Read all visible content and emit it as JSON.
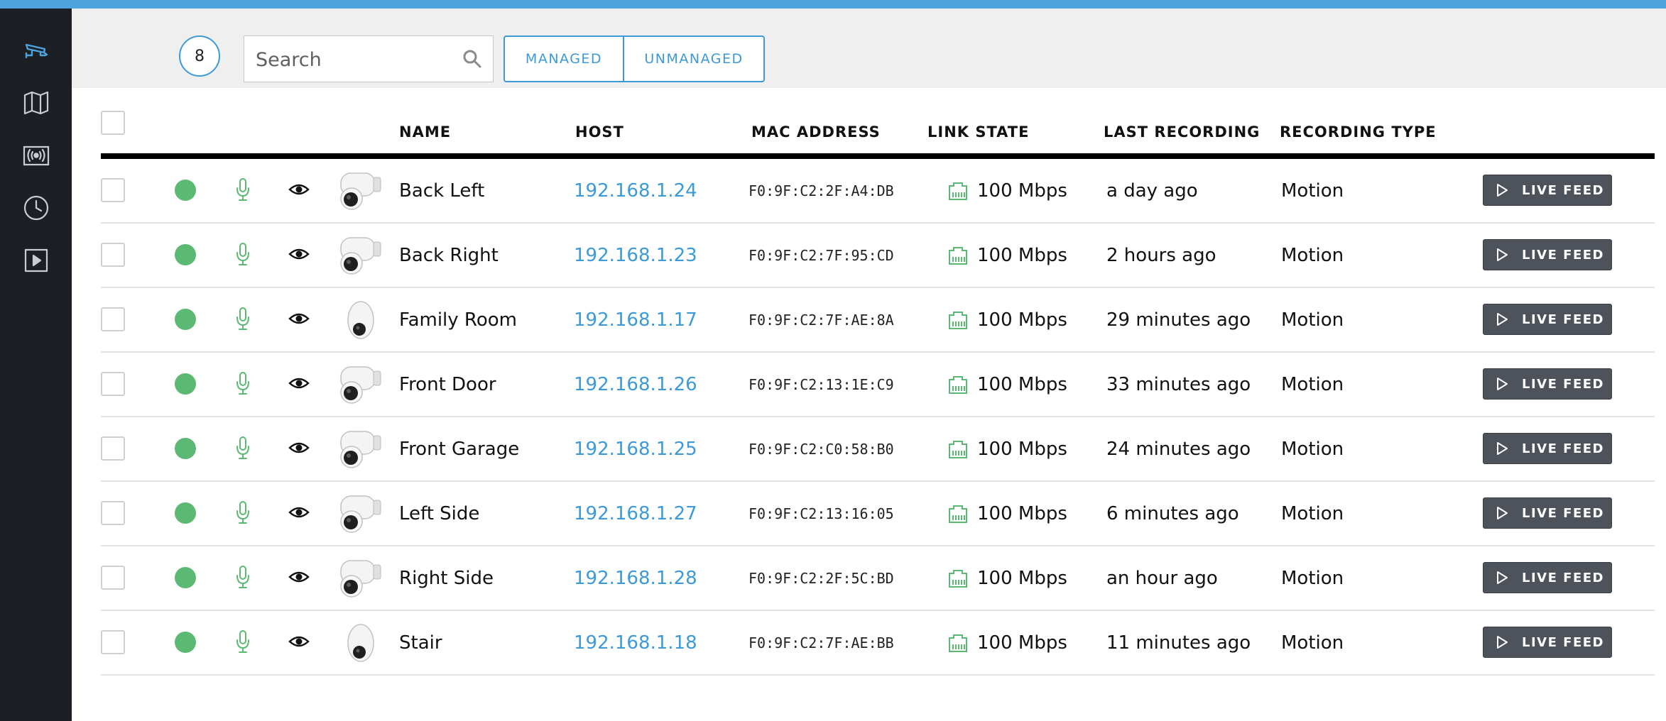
{
  "sidebar": {
    "items": [
      {
        "icon": "security-camera-icon",
        "active": true
      },
      {
        "icon": "map-icon",
        "active": false
      },
      {
        "icon": "broadcast-icon",
        "active": false
      },
      {
        "icon": "clock-icon",
        "active": false
      },
      {
        "icon": "video-play-icon",
        "active": false
      }
    ]
  },
  "header": {
    "camera_count": "8",
    "search_placeholder": "Search",
    "filters": {
      "managed": "MANAGED",
      "unmanaged": "UNMANAGED"
    }
  },
  "table": {
    "columns": {
      "name": "NAME",
      "host": "HOST",
      "mac": "MAC ADDRESS",
      "link": "LINK STATE",
      "last_recording": "LAST RECORDING",
      "recording_type": "RECORDING TYPE"
    },
    "rows": [
      {
        "name": "Back Left",
        "host": "192.168.1.24",
        "mac": "F0:9F:C2:2F:A4:DB",
        "link": "100 Mbps",
        "last_recording": "a day ago",
        "recording_type": "Motion",
        "action": "LIVE FEED",
        "model": "bullet"
      },
      {
        "name": "Back Right",
        "host": "192.168.1.23",
        "mac": "F0:9F:C2:7F:95:CD",
        "link": "100 Mbps",
        "last_recording": "2 hours ago",
        "recording_type": "Motion",
        "action": "LIVE FEED",
        "model": "bullet"
      },
      {
        "name": "Family Room",
        "host": "192.168.1.17",
        "mac": "F0:9F:C2:7F:AE:8A",
        "link": "100 Mbps",
        "last_recording": "29 minutes ago",
        "recording_type": "Motion",
        "action": "LIVE FEED",
        "model": "dome"
      },
      {
        "name": "Front Door",
        "host": "192.168.1.26",
        "mac": "F0:9F:C2:13:1E:C9",
        "link": "100 Mbps",
        "last_recording": "33 minutes ago",
        "recording_type": "Motion",
        "action": "LIVE FEED",
        "model": "bullet"
      },
      {
        "name": "Front Garage",
        "host": "192.168.1.25",
        "mac": "F0:9F:C2:C0:58:B0",
        "link": "100 Mbps",
        "last_recording": "24 minutes ago",
        "recording_type": "Motion",
        "action": "LIVE FEED",
        "model": "bullet"
      },
      {
        "name": "Left Side",
        "host": "192.168.1.27",
        "mac": "F0:9F:C2:13:16:05",
        "link": "100 Mbps",
        "last_recording": "6 minutes ago",
        "recording_type": "Motion",
        "action": "LIVE FEED",
        "model": "bullet"
      },
      {
        "name": "Right Side",
        "host": "192.168.1.28",
        "mac": "F0:9F:C2:2F:5C:BD",
        "link": "100 Mbps",
        "last_recording": "an hour ago",
        "recording_type": "Motion",
        "action": "LIVE FEED",
        "model": "bullet"
      },
      {
        "name": "Stair",
        "host": "192.168.1.18",
        "mac": "F0:9F:C2:7F:AE:BB",
        "link": "100 Mbps",
        "last_recording": "11 minutes ago",
        "recording_type": "Motion",
        "action": "LIVE FEED",
        "model": "dome"
      }
    ]
  },
  "colors": {
    "accent": "#3c9ad8",
    "status_online": "#5bb974",
    "sidebar_bg": "#1c1f24",
    "button_bg": "#4e535b"
  }
}
